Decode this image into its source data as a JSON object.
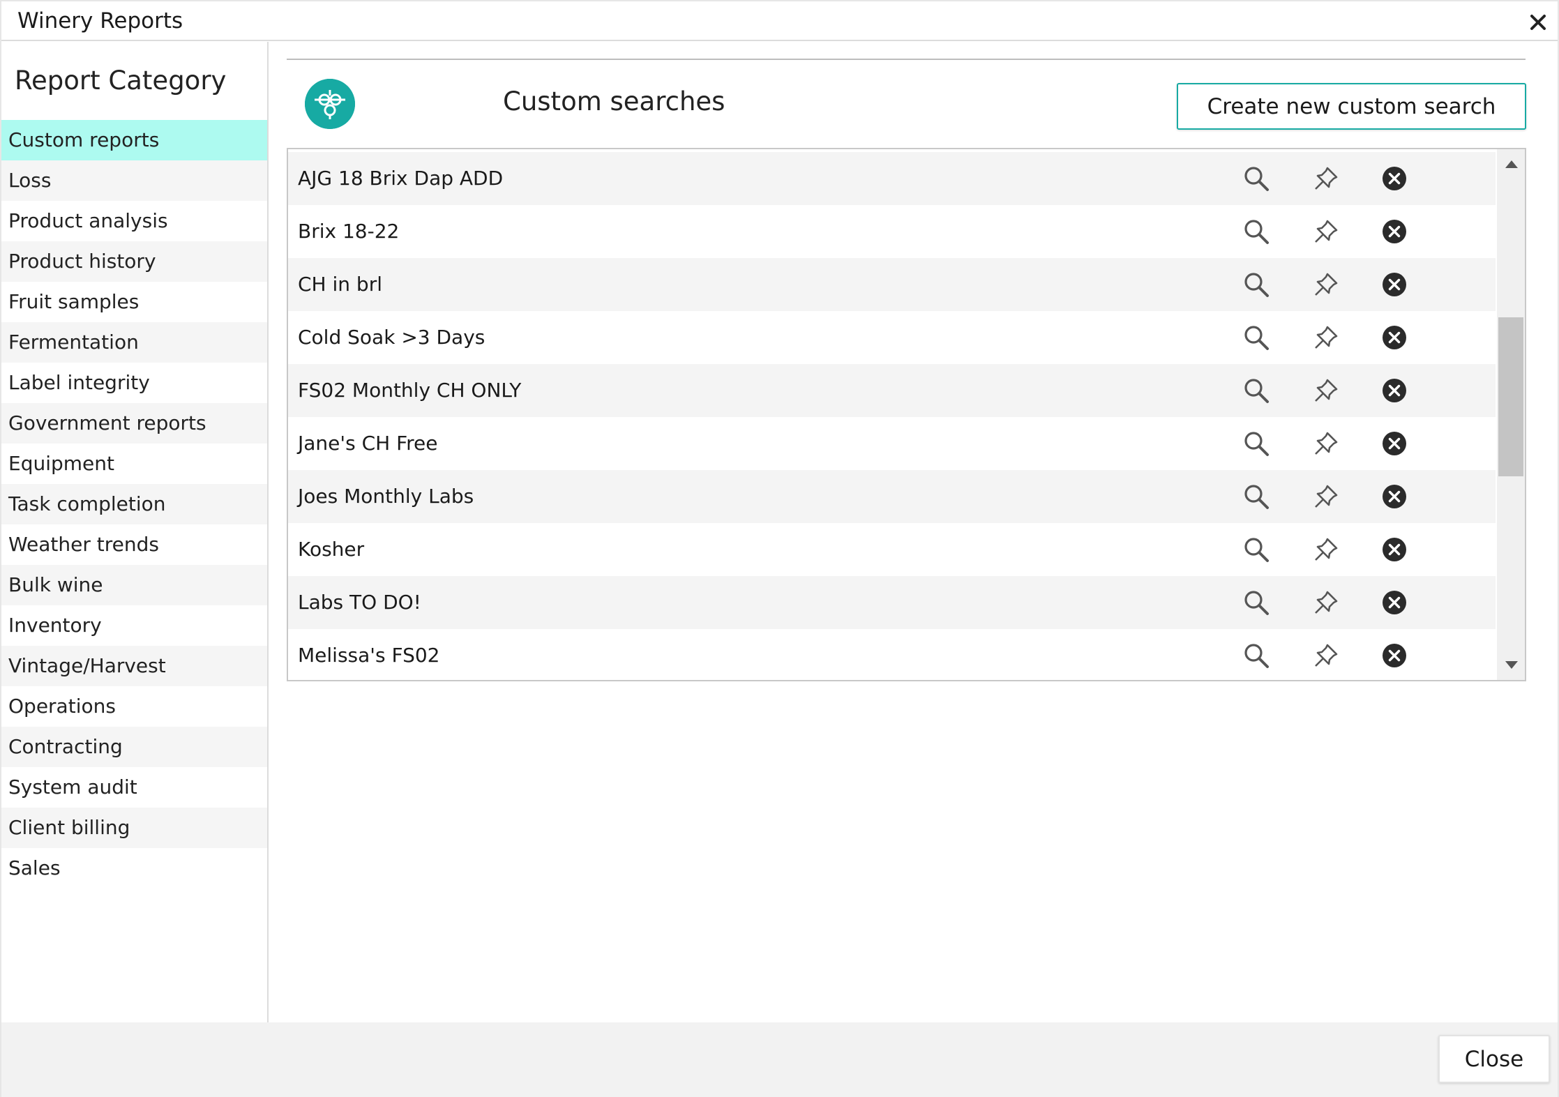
{
  "window": {
    "title": "Winery Reports"
  },
  "sidebar": {
    "heading": "Report Category",
    "items": [
      {
        "label": "Custom reports",
        "active": true
      },
      {
        "label": "Loss"
      },
      {
        "label": "Product analysis"
      },
      {
        "label": "Product history"
      },
      {
        "label": "Fruit samples"
      },
      {
        "label": "Fermentation"
      },
      {
        "label": "Label integrity"
      },
      {
        "label": "Government reports"
      },
      {
        "label": "Equipment"
      },
      {
        "label": "Task completion"
      },
      {
        "label": "Weather trends"
      },
      {
        "label": "Bulk wine"
      },
      {
        "label": "Inventory"
      },
      {
        "label": "Vintage/Harvest"
      },
      {
        "label": "Operations"
      },
      {
        "label": "Contracting"
      },
      {
        "label": "System audit"
      },
      {
        "label": "Client billing"
      },
      {
        "label": "Sales"
      }
    ]
  },
  "main": {
    "section_title": "Custom searches",
    "create_button_label": "Create new custom search",
    "searches": [
      {
        "name": "AJG 18 Brix Dap ADD"
      },
      {
        "name": "Brix 18-22"
      },
      {
        "name": "CH in brl"
      },
      {
        "name": "Cold Soak >3 Days"
      },
      {
        "name": "FS02 Monthly CH ONLY"
      },
      {
        "name": "Jane's CH Free"
      },
      {
        "name": "Joes Monthly Labs"
      },
      {
        "name": "Kosher"
      },
      {
        "name": "Labs TO DO!"
      },
      {
        "name": "Melissa's FS02"
      }
    ],
    "row_actions": [
      "search-icon",
      "pin-icon",
      "delete-icon"
    ]
  },
  "footer": {
    "close_label": "Close"
  },
  "colors": {
    "accent": "#17aaa3",
    "active_item_bg": "#adfaf0",
    "delete_icon": "#2b2b2b"
  }
}
